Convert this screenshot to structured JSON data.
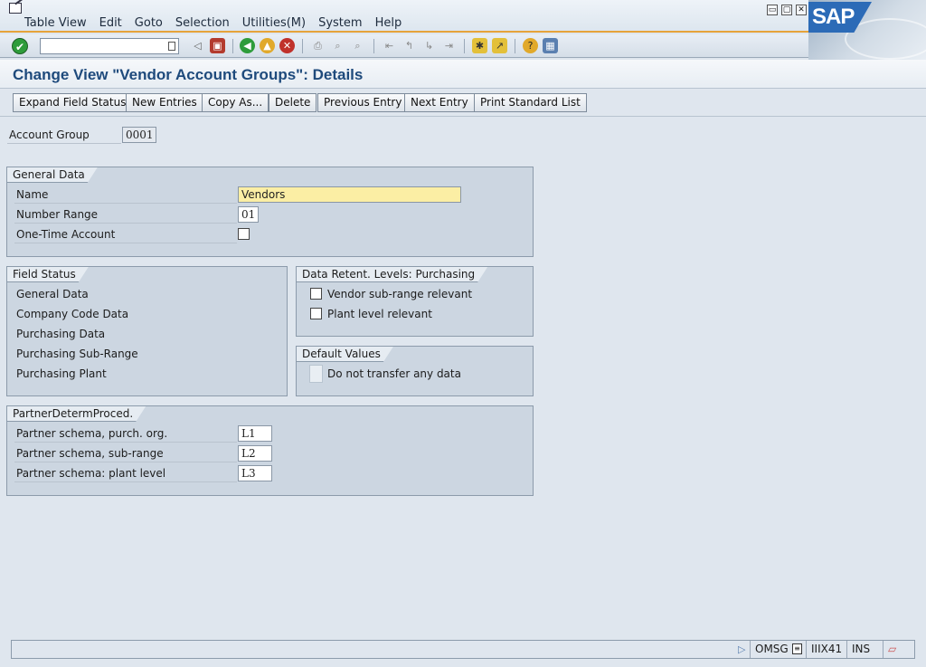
{
  "menu": {
    "items": [
      "Table View",
      "Edit",
      "Goto",
      "Selection",
      "Utilities(M)",
      "System",
      "Help"
    ]
  },
  "window_controls": {
    "minimize": "▭",
    "restore": "▢",
    "close": "✕"
  },
  "logo": "SAP",
  "toolbar": {
    "command_placeholder": "",
    "icons": [
      "enter-icon",
      "save-icon",
      "back-icon",
      "exit-icon",
      "cancel-icon",
      "print-icon",
      "find-icon",
      "find-next-icon",
      "first-page-icon",
      "previous-page-icon",
      "next-page-icon",
      "last-page-icon",
      "create-session-icon",
      "shortcut-icon",
      "help-icon",
      "layout-icon"
    ]
  },
  "page": {
    "title": "Change View \"Vendor Account Groups\": Details"
  },
  "app_buttons": [
    "Expand Field Status",
    "New Entries",
    "Copy As...",
    "Delete",
    "Previous Entry",
    "Next Entry",
    "Print Standard List"
  ],
  "account_group": {
    "label": "Account Group",
    "value": "0001"
  },
  "general_data": {
    "title": "General Data",
    "name_label": "Name",
    "name_value": "Vendors",
    "number_range_label": "Number Range",
    "number_range_value": "01",
    "one_time_label": "One-Time Account",
    "one_time_checked": false
  },
  "field_status": {
    "title": "Field Status",
    "items": [
      "General Data",
      "Company Code Data",
      "Purchasing Data",
      "Purchasing Sub-Range",
      "Purchasing Plant"
    ]
  },
  "data_retention": {
    "title": "Data Retent. Levels: Purchasing",
    "vendor_subrange_label": "Vendor sub-range relevant",
    "plant_level_label": "Plant level relevant"
  },
  "default_values": {
    "title": "Default Values",
    "no_transfer_label": "Do not transfer any data"
  },
  "partner": {
    "title": "PartnerDetermProced.",
    "rows": [
      {
        "label": "Partner schema, purch. org.",
        "value": "L1"
      },
      {
        "label": "Partner schema, sub-range",
        "value": "L2"
      },
      {
        "label": "Partner schema: plant level",
        "value": "L3"
      }
    ]
  },
  "status_bar": {
    "system": "OMSG",
    "server": "IIIX41",
    "mode": "INS"
  },
  "colors": {
    "title": "#1e4a7c",
    "accent": "#e6a33a",
    "focus_field": "#fbeea4",
    "group_bg": "#ccd6e1"
  }
}
